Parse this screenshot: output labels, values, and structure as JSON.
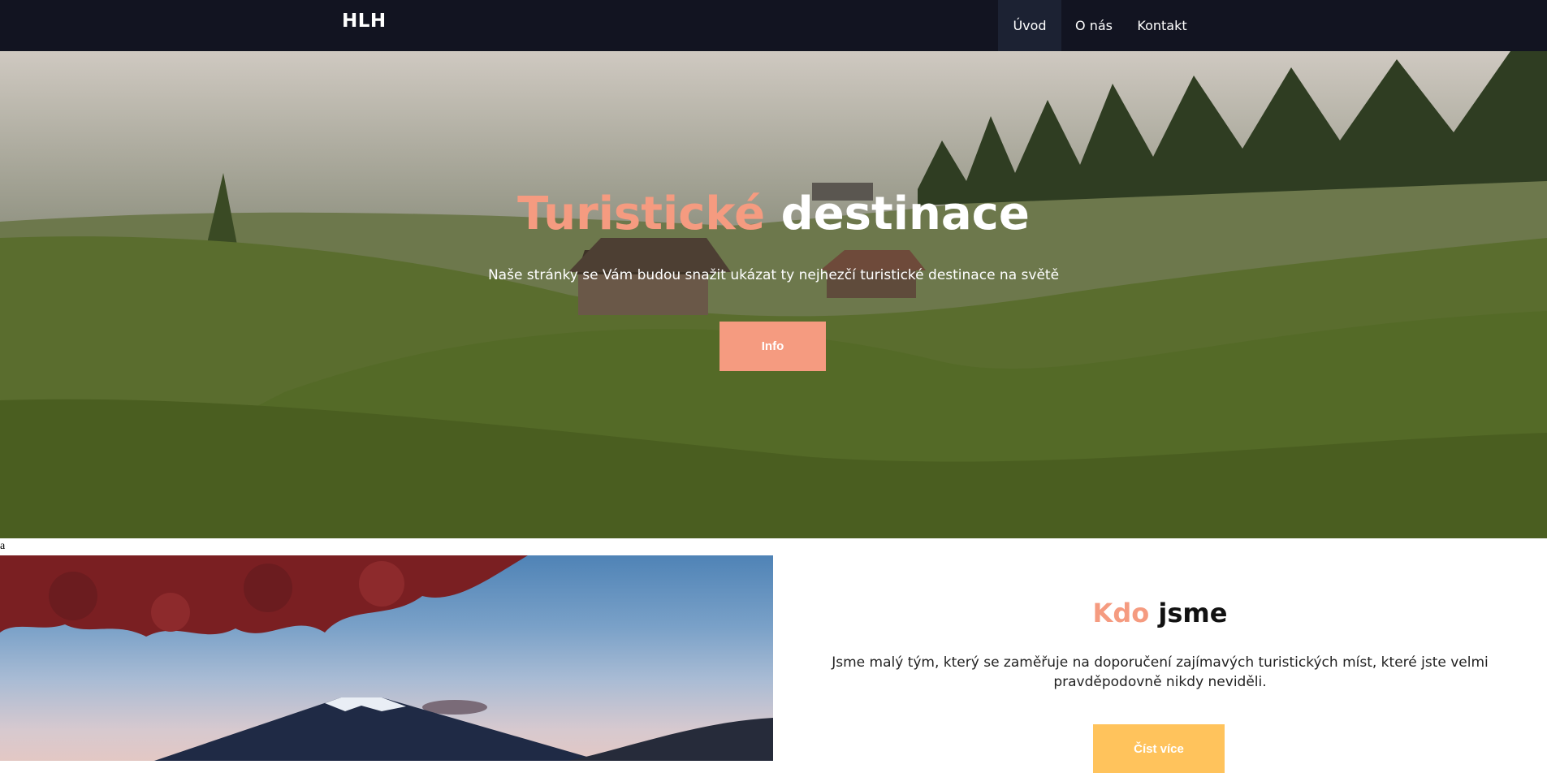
{
  "navbar": {
    "brand": "HLH",
    "items": [
      {
        "label": "Úvod",
        "active": true
      },
      {
        "label": "O nás",
        "active": false
      },
      {
        "label": "Kontakt",
        "active": false
      }
    ]
  },
  "hero": {
    "title_accent": "Turistické",
    "title_rest": "destinace",
    "subtitle": "Naše stránky se Vám budou snažit ukázat ty nejhezčí turistické destinace na světě",
    "button_label": "Info"
  },
  "stray_text": "a",
  "about": {
    "title_accent": "Kdo",
    "title_rest": "jsme",
    "text": "Jsme malý tým, který se zaměřuje na doporučení zajímavých turistických míst, které jste velmi pravděpodovně nikdy neviděli.",
    "button_label": "Číst více"
  },
  "colors": {
    "navbar_bg": "#121421",
    "accent": "#f59b80",
    "secondary_button": "#ffc35c"
  }
}
